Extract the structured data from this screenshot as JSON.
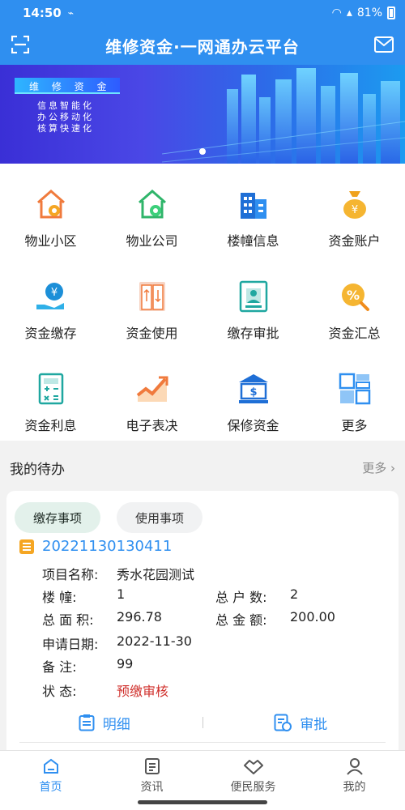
{
  "status": {
    "time": "14:50",
    "battery": "81%"
  },
  "header": {
    "title": "维修资金·一网通办云平台"
  },
  "banner": {
    "heading": "维 修 资 金",
    "lines": [
      "信息智能化",
      "办公移动化",
      "核算快速化"
    ]
  },
  "menu": [
    {
      "label": "物业小区",
      "icon": "house-gear-orange-icon"
    },
    {
      "label": "物业公司",
      "icon": "house-gear-green-icon"
    },
    {
      "label": "楼幢信息",
      "icon": "building-icon"
    },
    {
      "label": "资金账户",
      "icon": "money-bag-icon"
    },
    {
      "label": "资金缴存",
      "icon": "hand-coin-icon"
    },
    {
      "label": "资金使用",
      "icon": "elevator-icon"
    },
    {
      "label": "缴存审批",
      "icon": "approval-icon"
    },
    {
      "label": "资金汇总",
      "icon": "percent-search-icon"
    },
    {
      "label": "资金利息",
      "icon": "calculator-icon"
    },
    {
      "label": "电子表决",
      "icon": "trend-chart-icon"
    },
    {
      "label": "保修资金",
      "icon": "bank-icon"
    },
    {
      "label": "更多",
      "icon": "grid-more-icon"
    }
  ],
  "todo": {
    "title": "我的待办",
    "more": "更多",
    "tabs": [
      "缴存事项",
      "使用事项"
    ],
    "item": {
      "code": "20221130130411",
      "fields": {
        "project_key": "项目名称:",
        "project_val": "秀水花园测试",
        "building_key": "楼 幢:",
        "building_val": "1",
        "households_key": "总 户 数:",
        "households_val": "2",
        "area_key": "总 面 积:",
        "area_val": "296.78",
        "amount_key": "总 金 额:",
        "amount_val": "200.00",
        "date_key": "申请日期:",
        "date_val": "2022-11-30",
        "remark_key": "备 注:",
        "remark_val": "99",
        "status_key": "状 态:",
        "status_val": "预缴审核"
      },
      "actions": {
        "detail": "明细",
        "approve": "审批"
      }
    }
  },
  "nav": [
    {
      "label": "首页",
      "icon": "home-icon",
      "active": true
    },
    {
      "label": "资讯",
      "icon": "news-icon",
      "active": false
    },
    {
      "label": "便民服务",
      "icon": "handshake-icon",
      "active": false
    },
    {
      "label": "我的",
      "icon": "user-icon",
      "active": false
    }
  ]
}
